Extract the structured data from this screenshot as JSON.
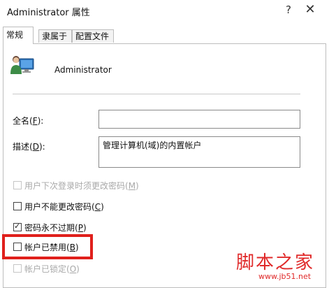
{
  "window": {
    "title": "Administrator 属性",
    "help_glyph": "?",
    "close_glyph": "✕"
  },
  "tabs": [
    {
      "label": "常规",
      "active": true
    },
    {
      "label": "隶属于",
      "active": false
    },
    {
      "label": "配置文件",
      "active": false
    }
  ],
  "general": {
    "user_name": "Administrator",
    "full_name": {
      "label_pre": "全名(",
      "access_key": "F",
      "label_post": "):",
      "value": ""
    },
    "description": {
      "label_pre": "描述(",
      "access_key": "D",
      "label_post": "):",
      "value": "管理计算机(域)的内置帐户"
    },
    "options": [
      {
        "pre": "用户下次登录时须更改密码(",
        "key": "M",
        "post": ")",
        "checked": false,
        "enabled": false
      },
      {
        "pre": "用户不能更改密码(",
        "key": "C",
        "post": ")",
        "checked": false,
        "enabled": true
      },
      {
        "pre": "密码永不过期(",
        "key": "P",
        "post": ")",
        "checked": true,
        "enabled": true
      },
      {
        "pre": "帐户已禁用(",
        "key": "B",
        "post": ")",
        "checked": false,
        "enabled": true
      },
      {
        "pre": "帐户已锁定(",
        "key": "O",
        "post": ")",
        "checked": false,
        "enabled": false
      }
    ],
    "check_glyph": "✓"
  },
  "watermark": {
    "logo_text": "脚本之家",
    "url": "www.jb51.net"
  },
  "colors": {
    "highlight": "#e0201c",
    "watermark": "#e02a2a"
  }
}
